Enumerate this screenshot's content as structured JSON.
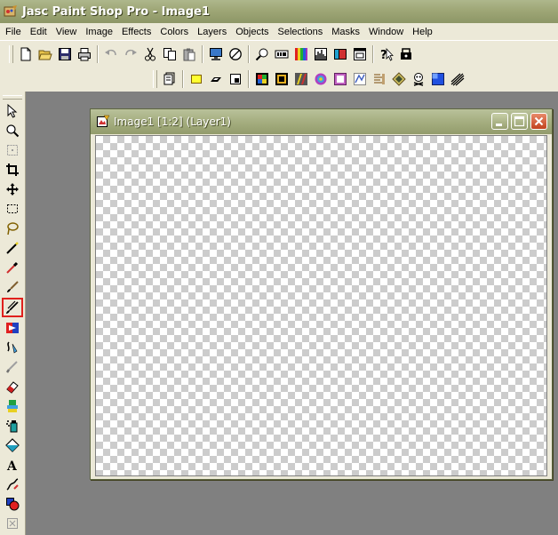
{
  "app": {
    "title": "Jasc Paint Shop Pro - Image1"
  },
  "menubar": {
    "items": [
      "File",
      "Edit",
      "View",
      "Image",
      "Effects",
      "Colors",
      "Layers",
      "Objects",
      "Selections",
      "Masks",
      "Window",
      "Help"
    ]
  },
  "toolbar_standard": {
    "buttons": [
      "new-icon",
      "open-icon",
      "save-icon",
      "print-icon",
      "undo-icon",
      "redo-icon",
      "cut-icon",
      "copy-icon",
      "paste-icon",
      "full-screen-preview-icon",
      "normal-viewing-icon",
      "zoom-icon",
      "tool-options-icon",
      "color-palette-icon",
      "histogram-icon",
      "layer-palette-icon",
      "overview-window-icon",
      "help-icon",
      "script-icon"
    ]
  },
  "toolbar_effects": {
    "buttons": [
      "browse-icon",
      "selection-rect-icon",
      "selection-freehand-icon",
      "selection-magic-icon",
      "arithmetic-icon",
      "frame-icon",
      "colorize-icon",
      "effect-browser-icon",
      "picture-frame-icon",
      "edge-effect-icon",
      "texture-icon",
      "artistic-icon",
      "blur-icon",
      "noise-icon",
      "color-balance-icon"
    ]
  },
  "tool_palette": {
    "tools": [
      "arrow-tool-icon",
      "zoom-tool-icon",
      "deform-tool-icon",
      "crop-tool-icon",
      "mover-tool-icon",
      "selection-tool-icon",
      "freehand-tool-icon",
      "magic-wand-tool-icon",
      "dropper-tool-icon",
      "paint-brush-tool-icon",
      "clone-brush-tool-icon",
      "color-replacer-tool-icon",
      "retouch-tool-icon",
      "scratch-remover-tool-icon",
      "eraser-tool-icon",
      "picture-tube-tool-icon",
      "airbrush-tool-icon",
      "flood-fill-tool-icon",
      "text-tool-icon",
      "draw-tool-icon",
      "preset-shapes-tool-icon",
      "object-selector-tool-icon"
    ],
    "selected": "clone-brush-tool-icon"
  },
  "document": {
    "title": "Image1 [1:2] (Layer1)"
  },
  "colors": {
    "titlebar": "#a0a878",
    "workspace": "#808080",
    "chrome": "#ece9d8",
    "selection_highlight": "#e0201c"
  }
}
